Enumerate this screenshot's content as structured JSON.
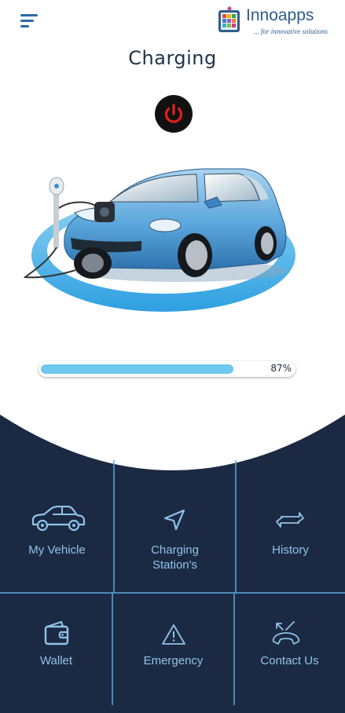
{
  "header": {
    "logo_name": "Innoapps",
    "logo_tagline": "... for innovative solutions",
    "menu_icon": "hamburger-menu-icon"
  },
  "page": {
    "title": "Charging",
    "power_icon": "power-icon"
  },
  "charge": {
    "percent": 87,
    "percent_label": "87%"
  },
  "menu": {
    "items": [
      {
        "label": "My Vehicle",
        "icon": "car-icon"
      },
      {
        "label": "Charging\nStation's",
        "icon": "navigation-arrow-icon"
      },
      {
        "label": "History",
        "icon": "swap-arrows-icon"
      },
      {
        "label": "Wallet",
        "icon": "wallet-icon"
      },
      {
        "label": "Emergency",
        "icon": "warning-icon"
      },
      {
        "label": "Contact Us",
        "icon": "phone-callback-icon"
      }
    ]
  },
  "colors": {
    "panel_bg": "#1b2a42",
    "grid_line": "#5aa8e0",
    "icon_color": "#8fc3ea",
    "progress_fill": "#6ec8ef",
    "power_red": "#e0201f"
  }
}
